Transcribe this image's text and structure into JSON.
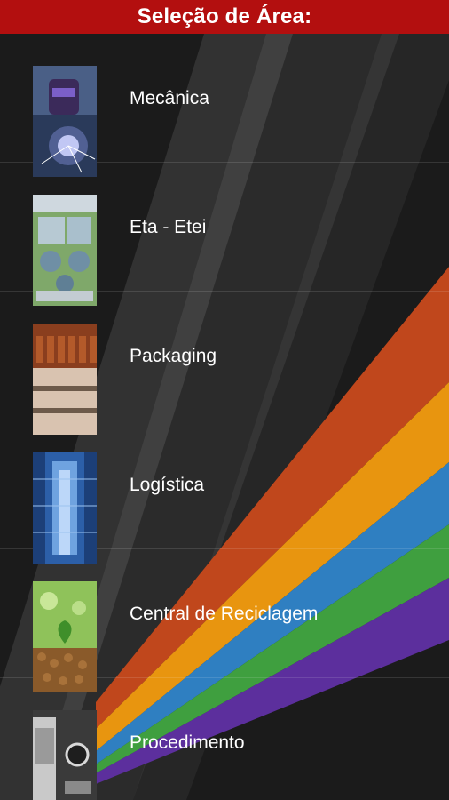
{
  "header": {
    "title": "Seleção de Área:"
  },
  "colors": {
    "header_bg": "#b30f0f",
    "background": "#1b1b1b",
    "stripes": [
      "#c0471c",
      "#e8950f",
      "#2f7fc1",
      "#3f9f3f",
      "#5c2f9d"
    ]
  },
  "areas": [
    {
      "label": "Mecânica",
      "image": "welding-icon"
    },
    {
      "label": "Eta - Etei",
      "image": "water-treatment-icon"
    },
    {
      "label": "Packaging",
      "image": "bottling-line-icon"
    },
    {
      "label": "Logística",
      "image": "warehouse-icon"
    },
    {
      "label": "Central de Reciclagem",
      "image": "recycling-pellets-icon"
    },
    {
      "label": "Procedimento",
      "image": "desk-laptop-icon"
    }
  ]
}
